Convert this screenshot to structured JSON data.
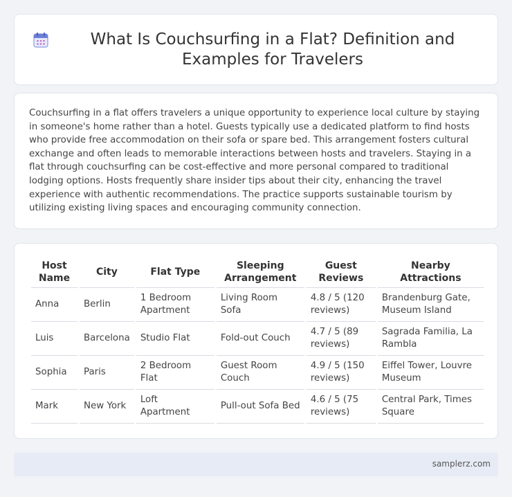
{
  "header": {
    "icon": "calendar-icon",
    "title": "What Is Couchsurfing in a Flat? Definition and Examples for Travelers"
  },
  "intro": {
    "text": "Couchsurfing in a flat offers travelers a unique opportunity to experience local culture by staying in someone's home rather than a hotel. Guests typically use a dedicated platform to find hosts who provide free accommodation on their sofa or spare bed. This arrangement fosters cultural exchange and often leads to memorable interactions between hosts and travelers. Staying in a flat through couchsurfing can be cost-effective and more personal compared to traditional lodging options. Hosts frequently share insider tips about their city, enhancing the travel experience with authentic recommendations. The practice supports sustainable tourism by utilizing existing living spaces and encouraging community connection."
  },
  "table": {
    "columns": [
      "Host Name",
      "City",
      "Flat Type",
      "Sleeping Arrangement",
      "Guest Reviews",
      "Nearby Attractions"
    ],
    "rows": [
      [
        "Anna",
        "Berlin",
        "1 Bedroom Apartment",
        "Living Room Sofa",
        "4.8 / 5 (120 reviews)",
        "Brandenburg Gate, Museum Island"
      ],
      [
        "Luis",
        "Barcelona",
        "Studio Flat",
        "Fold-out Couch",
        "4.7 / 5 (89 reviews)",
        "Sagrada Familia, La Rambla"
      ],
      [
        "Sophia",
        "Paris",
        "2 Bedroom Flat",
        "Guest Room Couch",
        "4.9 / 5 (150 reviews)",
        "Eiffel Tower, Louvre Museum"
      ],
      [
        "Mark",
        "New York",
        "Loft Apartment",
        "Pull-out Sofa Bed",
        "4.6 / 5 (75 reviews)",
        "Central Park, Times Square"
      ]
    ]
  },
  "footer": {
    "brand": "samplerz.com"
  },
  "colors": {
    "background": "#f2f3f7",
    "card": "#ffffff",
    "footer": "#e6ebf5",
    "icon_accent": "#6b7fd7"
  }
}
